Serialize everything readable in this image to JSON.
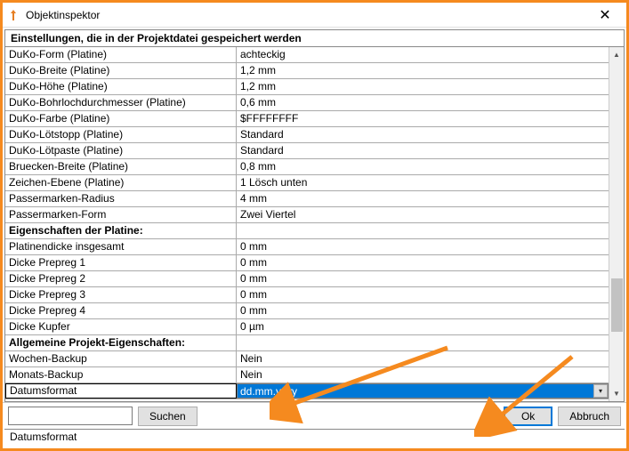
{
  "window": {
    "title": "Objektinspektor"
  },
  "section_header": "Einstellungen, die in der Projektdatei gespeichert werden",
  "rows": [
    {
      "label": "DuKo-Form (Platine)",
      "value": "achteckig"
    },
    {
      "label": "DuKo-Breite (Platine)",
      "value": "1,2 mm"
    },
    {
      "label": "DuKo-Höhe (Platine)",
      "value": "1,2 mm"
    },
    {
      "label": "DuKo-Bohrlochdurchmesser (Platine)",
      "value": "0,6 mm"
    },
    {
      "label": "DuKo-Farbe (Platine)",
      "value": "$FFFFFFFF"
    },
    {
      "label": "DuKo-Lötstopp (Platine)",
      "value": "Standard"
    },
    {
      "label": "DuKo-Lötpaste (Platine)",
      "value": "Standard"
    },
    {
      "label": "Bruecken-Breite (Platine)",
      "value": "0,8 mm"
    },
    {
      "label": "Zeichen-Ebene (Platine)",
      "value": "1 Lösch unten"
    },
    {
      "label": "Passermarken-Radius",
      "value": "4 mm"
    },
    {
      "label": "Passermarken-Form",
      "value": "Zwei Viertel"
    },
    {
      "label": "Eigenschaften der Platine:",
      "value": "",
      "group": true
    },
    {
      "label": "Platinendicke insgesamt",
      "value": "0 mm"
    },
    {
      "label": "Dicke Prepreg 1",
      "value": "0 mm"
    },
    {
      "label": "Dicke Prepreg 2",
      "value": "0 mm"
    },
    {
      "label": "Dicke Prepreg 3",
      "value": "0 mm"
    },
    {
      "label": "Dicke Prepreg 4",
      "value": "0 mm"
    },
    {
      "label": "Dicke Kupfer",
      "value": "0 µm"
    },
    {
      "label": "Allgemeine Projekt-Eigenschaften:",
      "value": "",
      "group": true
    },
    {
      "label": "Wochen-Backup",
      "value": "Nein"
    },
    {
      "label": "Monats-Backup",
      "value": "Nein"
    },
    {
      "label": "Datumsformat",
      "value": "dd.mm.yyyy",
      "selected": true
    }
  ],
  "buttons": {
    "search": "Suchen",
    "ok": "Ok",
    "cancel": "Abbruch"
  },
  "search": {
    "value": ""
  },
  "status": "Datumsformat",
  "colors": {
    "accent": "#f58a1f",
    "select": "#0078d7"
  }
}
